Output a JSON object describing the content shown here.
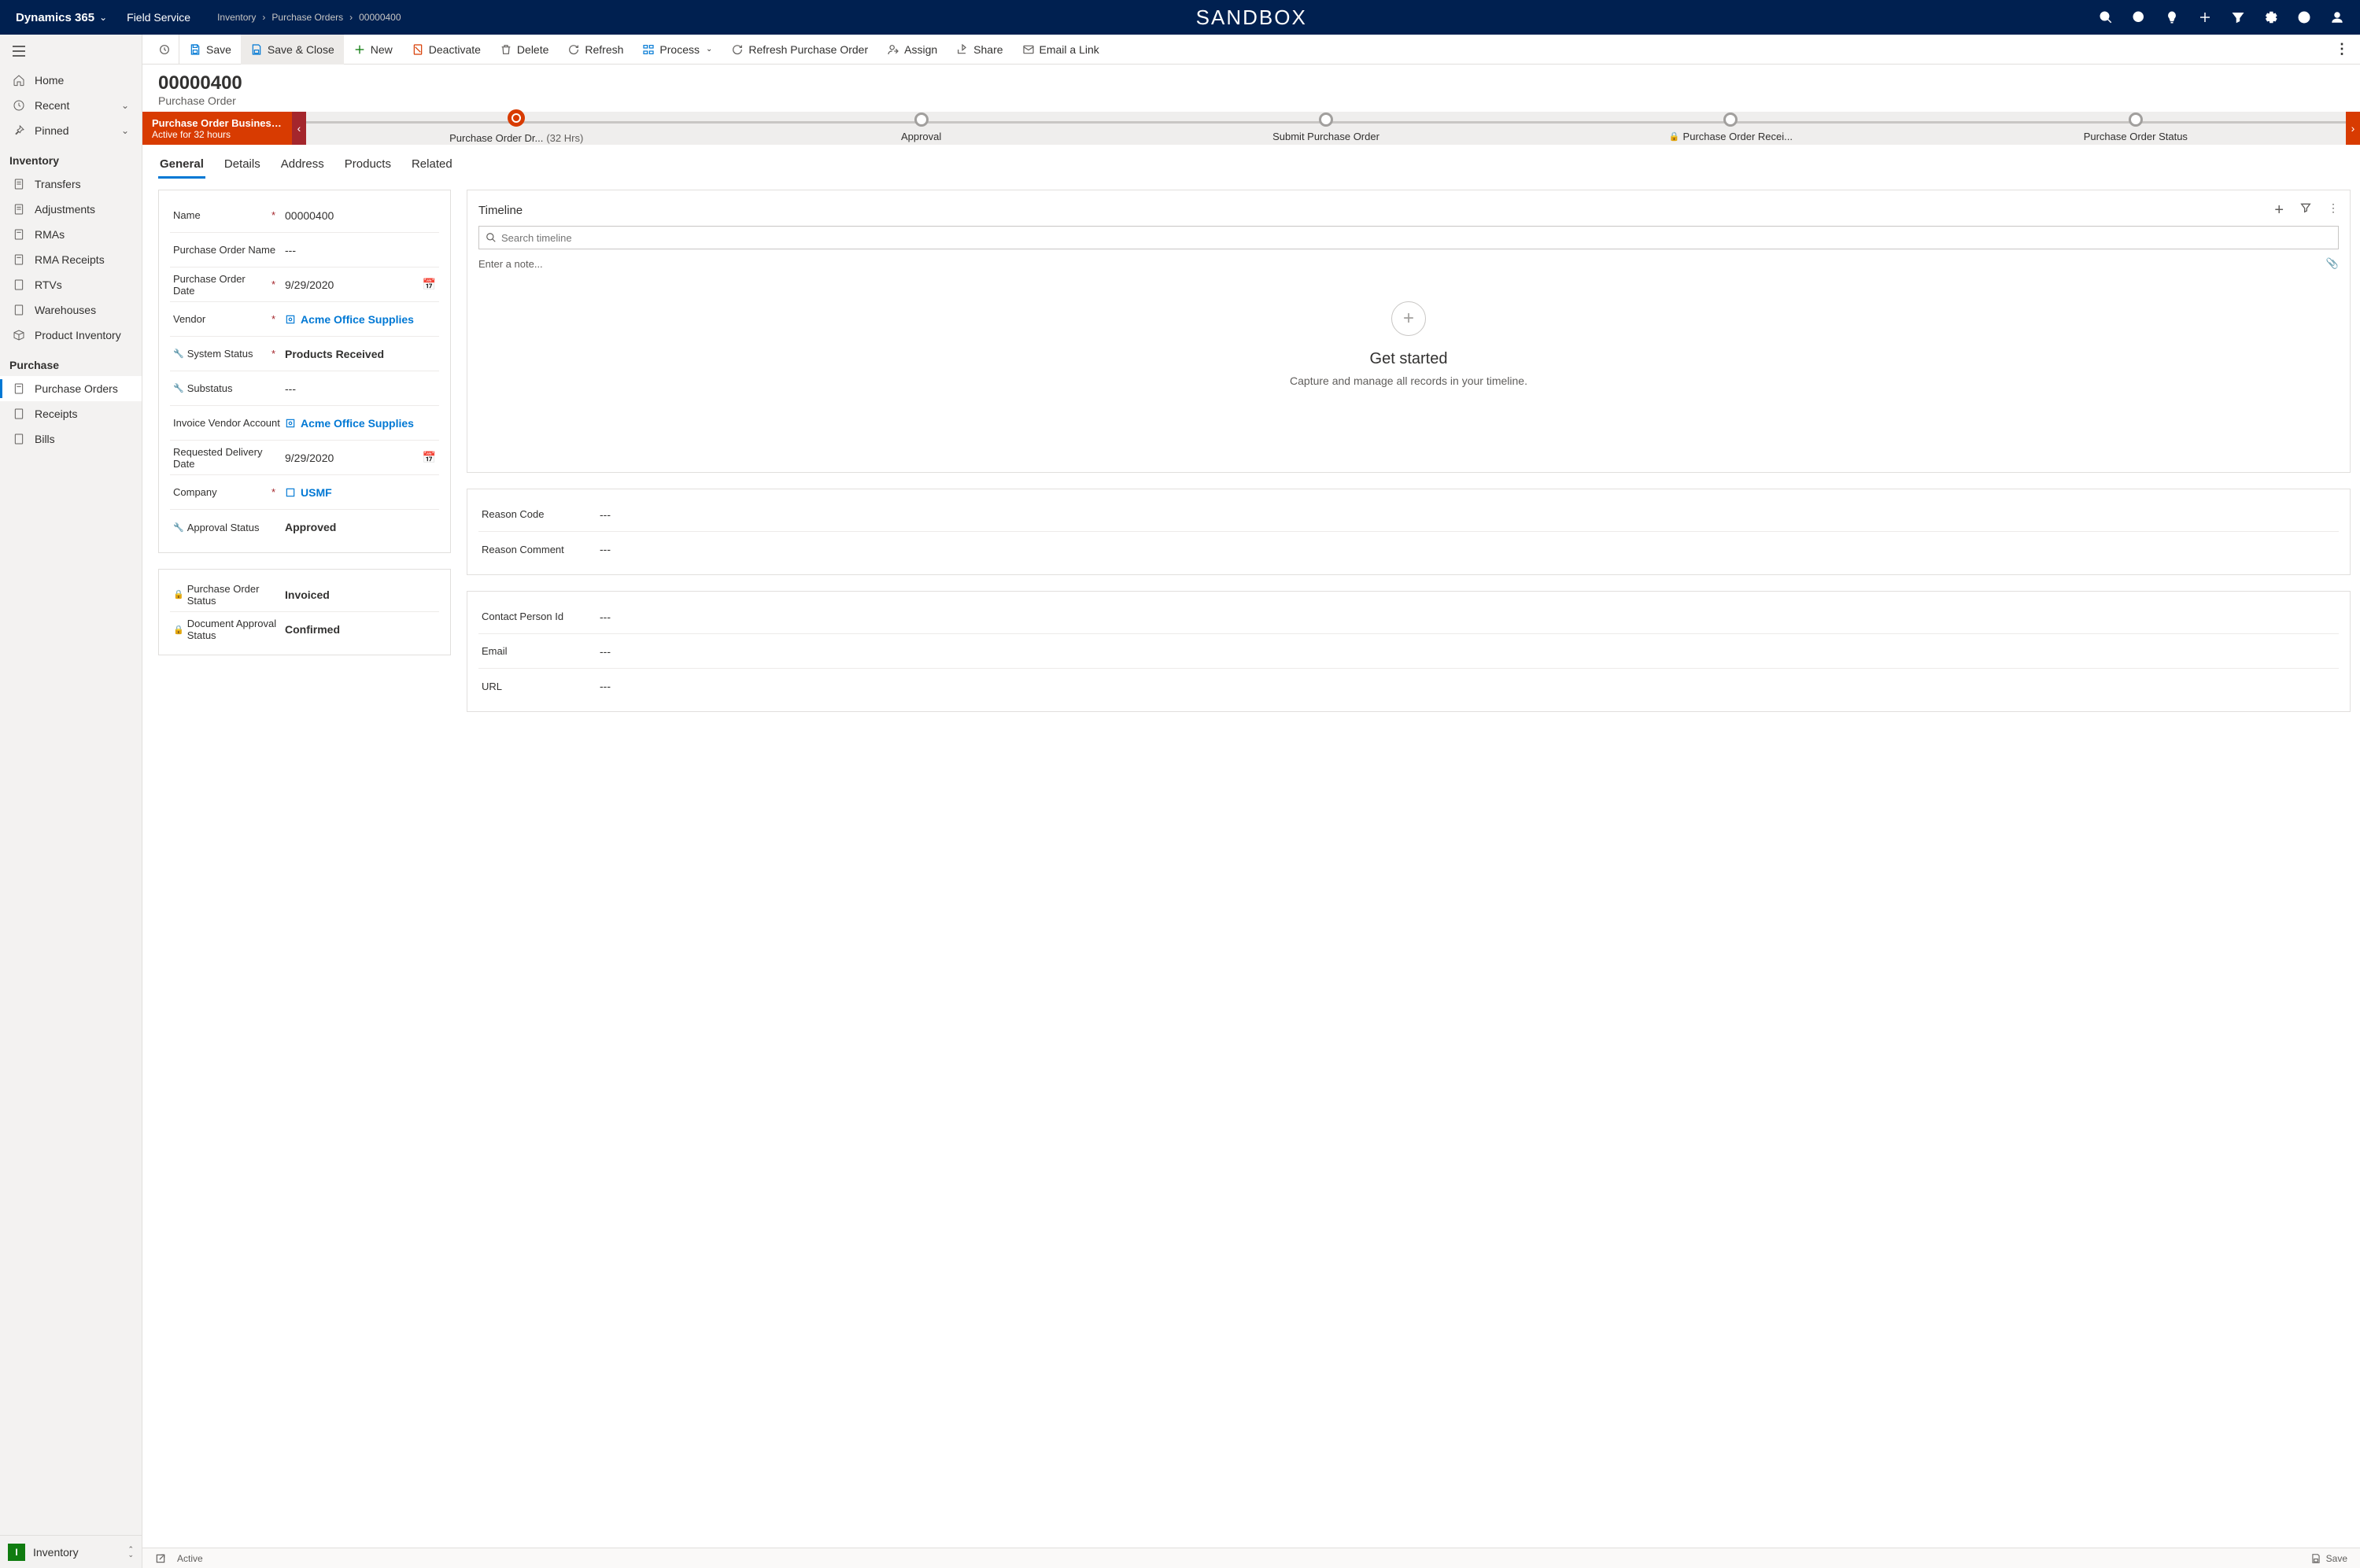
{
  "topnav": {
    "brand": "Dynamics 365",
    "app": "Field Service",
    "breadcrumb": [
      "Inventory",
      "Purchase Orders",
      "00000400"
    ],
    "environment": "SANDBOX"
  },
  "sidebar": {
    "home": "Home",
    "recent": "Recent",
    "pinned": "Pinned",
    "section_inventory": "Inventory",
    "inv_items": [
      "Transfers",
      "Adjustments",
      "RMAs",
      "RMA Receipts",
      "RTVs",
      "Warehouses",
      "Product Inventory"
    ],
    "section_purchase": "Purchase",
    "purchase_items": [
      "Purchase Orders",
      "Receipts",
      "Bills"
    ],
    "app_switch_badge": "I",
    "app_switch_label": "Inventory"
  },
  "commands": {
    "back": "",
    "save": "Save",
    "save_close": "Save & Close",
    "new": "New",
    "deactivate": "Deactivate",
    "delete": "Delete",
    "refresh": "Refresh",
    "process": "Process",
    "refresh_po": "Refresh Purchase Order",
    "assign": "Assign",
    "share": "Share",
    "email_link": "Email a Link"
  },
  "header": {
    "title": "00000400",
    "subtitle": "Purchase Order"
  },
  "process": {
    "flag_title": "Purchase Order Business ...",
    "flag_sub": "Active for 32 hours",
    "stages": [
      {
        "label": "Purchase Order Dr...",
        "time": "(32 Hrs)",
        "active": true,
        "locked": false
      },
      {
        "label": "Approval",
        "time": "",
        "active": false,
        "locked": false
      },
      {
        "label": "Submit Purchase Order",
        "time": "",
        "active": false,
        "locked": false
      },
      {
        "label": "Purchase Order Recei...",
        "time": "",
        "active": false,
        "locked": true
      },
      {
        "label": "Purchase Order Status",
        "time": "",
        "active": false,
        "locked": false
      }
    ]
  },
  "tabs": [
    "General",
    "Details",
    "Address",
    "Products",
    "Related"
  ],
  "fields": {
    "name_label": "Name",
    "name_value": "00000400",
    "poname_label": "Purchase Order Name",
    "poname_value": "---",
    "podate_label": "Purchase Order Date",
    "podate_value": "9/29/2020",
    "vendor_label": "Vendor",
    "vendor_value": "Acme Office Supplies",
    "sysstatus_label": "System Status",
    "sysstatus_value": "Products Received",
    "substatus_label": "Substatus",
    "substatus_value": "---",
    "invvendor_label": "Invoice Vendor Account",
    "invvendor_value": "Acme Office Supplies",
    "reqdate_label": "Requested Delivery Date",
    "reqdate_value": "9/29/2020",
    "company_label": "Company",
    "company_value": "USMF",
    "approval_label": "Approval Status",
    "approval_value": "Approved",
    "postatus_label": "Purchase Order Status",
    "postatus_value": "Invoiced",
    "docapproval_label": "Document Approval Status",
    "docapproval_value": "Confirmed"
  },
  "timeline": {
    "title": "Timeline",
    "search_placeholder": "Search timeline",
    "note_placeholder": "Enter a note...",
    "empty_title": "Get started",
    "empty_sub": "Capture and manage all records in your timeline."
  },
  "right_card1": {
    "reason_code_label": "Reason Code",
    "reason_code_value": "---",
    "reason_comment_label": "Reason Comment",
    "reason_comment_value": "---"
  },
  "right_card2": {
    "contact_label": "Contact Person Id",
    "contact_value": "---",
    "email_label": "Email",
    "email_value": "---",
    "url_label": "URL",
    "url_value": "---"
  },
  "footer": {
    "status": "Active",
    "save": "Save"
  }
}
